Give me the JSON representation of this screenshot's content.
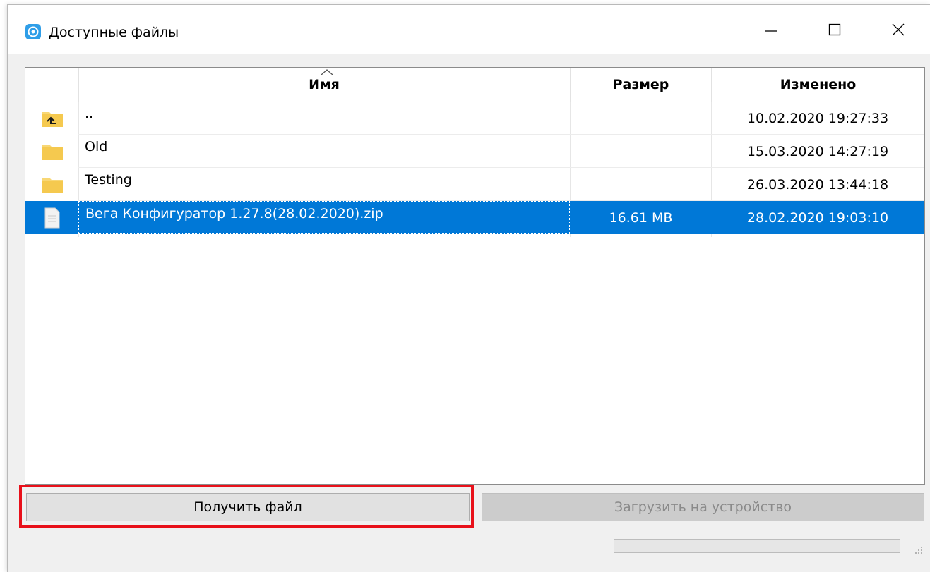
{
  "window": {
    "title": "Доступные файлы",
    "icon": "app-logo-icon"
  },
  "columns": {
    "name": "Имя",
    "size": "Размер",
    "modified": "Изменено"
  },
  "files": [
    {
      "icon": "folder-up-icon",
      "name": "..",
      "size": "",
      "modified": "10.02.2020 19:27:33"
    },
    {
      "icon": "folder-icon",
      "name": "Old",
      "size": "",
      "modified": "15.03.2020 14:27:19"
    },
    {
      "icon": "folder-icon",
      "name": "Testing",
      "size": "",
      "modified": "26.03.2020 13:44:18"
    },
    {
      "icon": "file-icon",
      "name": "Вега Конфигуратор 1.27.8(28.02.2020).zip",
      "size": "16.61 MB",
      "modified": "28.02.2020 19:03:10",
      "selected": true
    }
  ],
  "buttons": {
    "get_file": "Получить файл",
    "upload_to_device": "Загрузить на устройство"
  },
  "colors": {
    "selection": "#0078d7",
    "highlight": "#e8101a",
    "folder": "#f8d775"
  }
}
